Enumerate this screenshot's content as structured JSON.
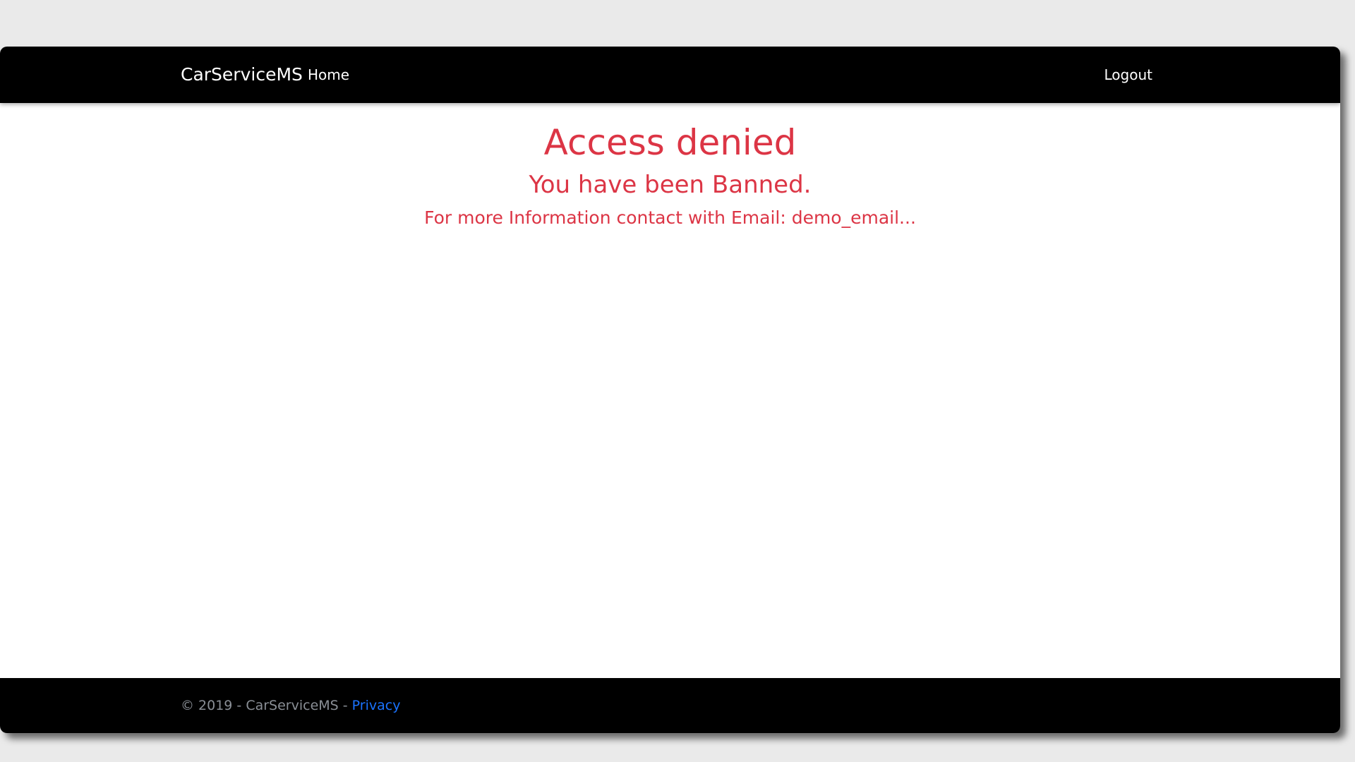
{
  "navbar": {
    "brand": "CarServiceMS",
    "home_label": "Home",
    "logout_label": "Logout"
  },
  "main": {
    "title": "Access denied",
    "subtitle": "You have been Banned.",
    "message": "For more Information contact with Email: demo_email..."
  },
  "footer": {
    "copyright": "© 2019 - CarServiceMS - ",
    "privacy_label": "Privacy"
  },
  "colors": {
    "navbar_bg": "#000000",
    "danger": "#dc3545",
    "link": "#1a73ff",
    "footer_text": "#8a8f96"
  }
}
